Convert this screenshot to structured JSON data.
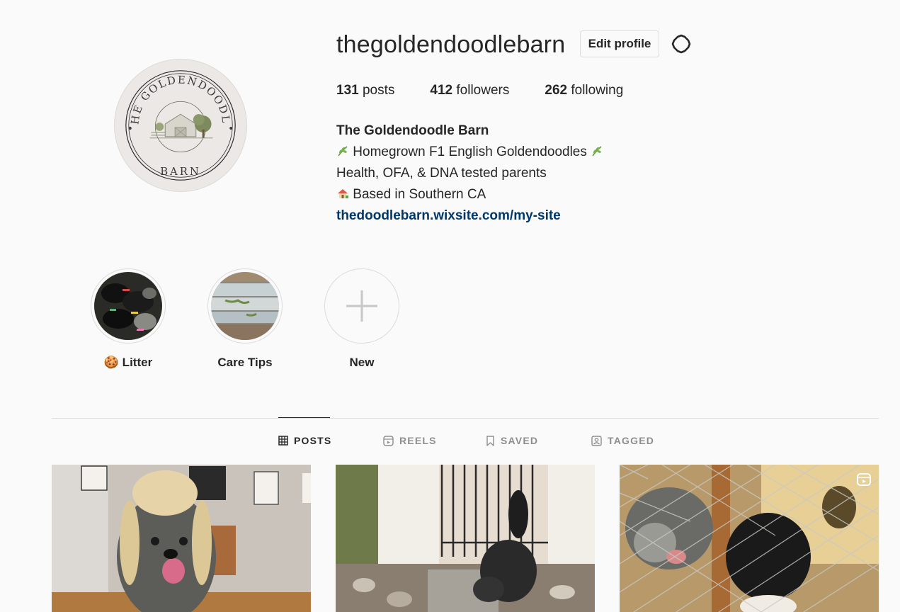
{
  "profile": {
    "username": "thegoldendoodlebarn",
    "edit_profile_label": "Edit profile",
    "avatar_text_top": "THE GOLDENDOODLE",
    "avatar_text_bottom": "BARN",
    "stats": {
      "posts_count": "131",
      "posts_label": "posts",
      "followers_count": "412",
      "followers_label": "followers",
      "following_count": "262",
      "following_label": "following"
    },
    "bio": {
      "name": "The Goldendoodle Barn",
      "line1": "Homegrown F1 English Goldendoodles",
      "line2": "Health, OFA, & DNA tested parents",
      "line3": "Based in Southern CA",
      "link": "thedoodlebarn.wixsite.com/my-site"
    }
  },
  "highlights": [
    {
      "label": "🍪 Litter",
      "icon": "puppies-photo"
    },
    {
      "label": "Care Tips",
      "icon": "wood-photo"
    },
    {
      "label": "New",
      "icon": "plus-icon"
    }
  ],
  "tabs": [
    {
      "label": "POSTS",
      "icon": "grid-icon",
      "active": true
    },
    {
      "label": "REELS",
      "icon": "reels-icon",
      "active": false
    },
    {
      "label": "SAVED",
      "icon": "bookmark-icon",
      "active": false
    },
    {
      "label": "TAGGED",
      "icon": "tagged-icon",
      "active": false
    }
  ],
  "colors": {
    "background": "#fafafa",
    "text": "#262626",
    "link": "#00376b",
    "muted": "#8e8e8e",
    "border": "#dbdbdb"
  }
}
